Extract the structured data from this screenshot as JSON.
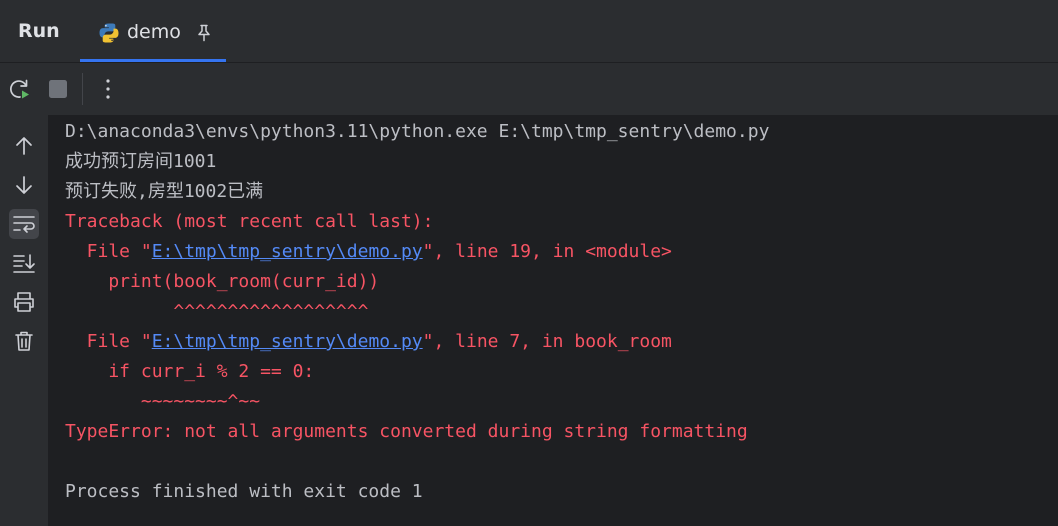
{
  "header": {
    "run_title": "Run",
    "tab_label": "demo"
  },
  "console": {
    "cmd": "D:\\anaconda3\\envs\\python3.11\\python.exe E:\\tmp\\tmp_sentry\\demo.py",
    "out1": "成功预订房间1001",
    "out2": "预订失败,房型1002已满",
    "traceback": "Traceback (most recent call last):",
    "frame1_prefix": "  File \"",
    "frame1_link": "E:\\tmp\\tmp_sentry\\demo.py",
    "frame1_suffix": "\", line 19, in <module>",
    "frame1_code": "    print(book_room(curr_id))",
    "frame1_marker": "          ^^^^^^^^^^^^^^^^^^",
    "frame2_prefix": "  File \"",
    "frame2_link": "E:\\tmp\\tmp_sentry\\demo.py",
    "frame2_suffix": "\", line 7, in book_room",
    "frame2_code": "    if curr_i % 2 == 0:",
    "frame2_marker": "       ~~~~~~~~^~~",
    "error": "TypeError: not all arguments converted during string formatting",
    "exit": "Process finished with exit code 1"
  },
  "icons": {
    "rerun": "rerun-icon",
    "stop": "stop-icon",
    "more": "more-vertical-icon",
    "up": "arrow-up-icon",
    "down": "arrow-down-icon",
    "wrap": "soft-wrap-icon",
    "scroll_end": "scroll-to-end-icon",
    "print": "print-icon",
    "clear": "trash-icon",
    "python": "python-icon",
    "pin": "pin-icon"
  },
  "colors": {
    "background": "#1e1f22",
    "panel": "#2b2d30",
    "text": "#bcbec4",
    "error": "#f75464",
    "link": "#548af7",
    "accent": "#3574f0"
  }
}
